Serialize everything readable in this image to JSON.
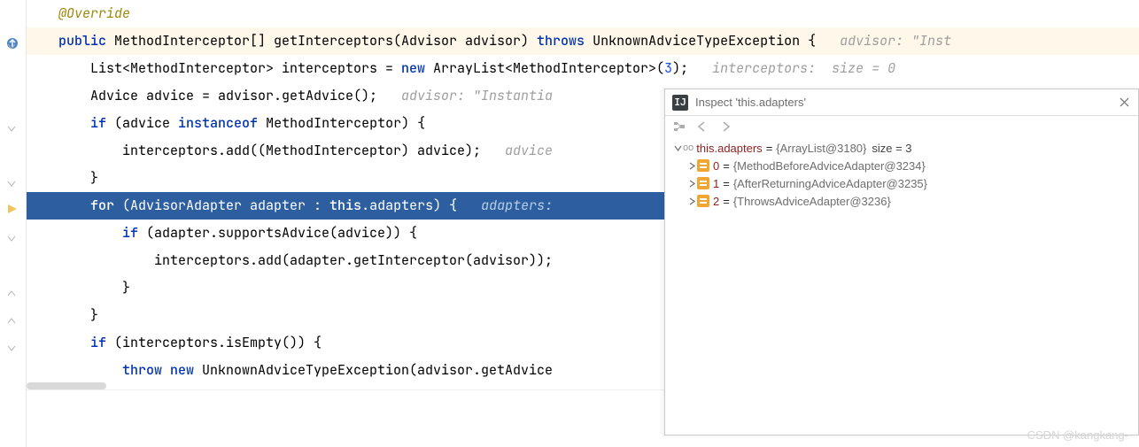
{
  "code": {
    "l1": "@Override",
    "l2a": "public",
    "l2b": " MethodInterceptor[] getInterceptors(Advisor advisor) ",
    "l2c": "throws",
    "l2d": " UnknownAdviceTypeException {",
    "l2hint": "advisor: \"Inst",
    "l3a": "List<MethodInterceptor> interceptors = ",
    "l3b": "new",
    "l3c": " ArrayList<MethodInterceptor>(",
    "l3n": "3",
    "l3d": ");",
    "l3hint": "interceptors:  size = 0",
    "l4a": "Advice advice = advisor.getAdvice();",
    "l4hint": "advisor: \"Instantia",
    "l5a": "if",
    "l5b": " (advice ",
    "l5c": "instanceof",
    "l5d": " MethodInterceptor) {",
    "l6a": "interceptors.add((MethodInterceptor) advice);",
    "l6hint": "advice",
    "l7a": "}",
    "l8a": "for",
    "l8b": " (AdvisorAdapter adapter : ",
    "l8c": "this",
    "l8d": ".adapters) {",
    "l8hint": "adapters:",
    "l9a": "if",
    "l9b": " (adapter.supportsAdvice(advice)) {",
    "l10a": "interceptors.add(adapter.getInterceptor(advisor));",
    "l11a": "}",
    "l12a": "}",
    "l13a": "if",
    "l13b": " (interceptors.isEmpty()) {",
    "l14a": "throw new",
    "l14b": " UnknownAdviceTypeException(advisor.getAdvice"
  },
  "inspect": {
    "title": "Inspect 'this.adapters'",
    "root": {
      "name": "this.adapters",
      "eq": "=",
      "val": "{ArrayList@3180}",
      "size": "size = 3"
    },
    "items": [
      {
        "idx": "0",
        "eq": "=",
        "val": "{MethodBeforeAdviceAdapter@3234}"
      },
      {
        "idx": "1",
        "eq": "=",
        "val": "{AfterReturningAdviceAdapter@3235}"
      },
      {
        "idx": "2",
        "eq": "=",
        "val": "{ThrowsAdviceAdapter@3236}"
      }
    ]
  },
  "watermark": "CSDN @kangkang-"
}
